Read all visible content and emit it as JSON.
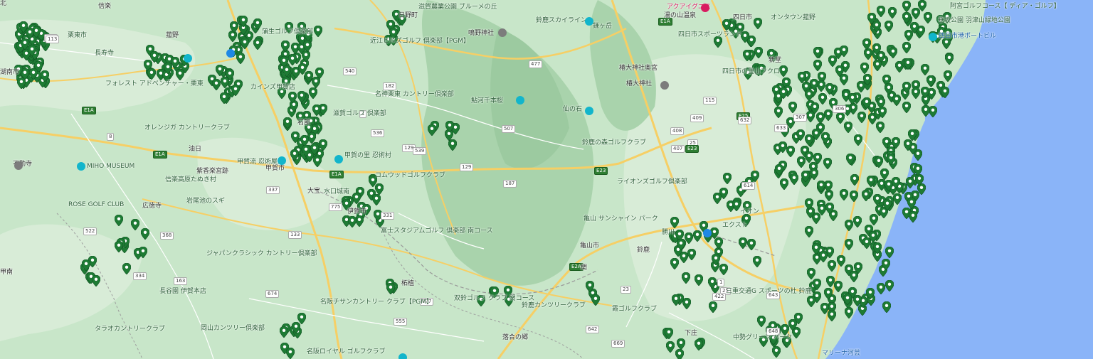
{
  "colors": {
    "land": "#c8e6c9",
    "land_light": "#dcefdc",
    "mountain": "#b3d9b5",
    "sea": "#8ab4f8",
    "road_major": "#f6cf65",
    "road_minor": "#ffffff",
    "pin": "#1e7b34",
    "pin_dark": "#0f5222"
  },
  "labels": [
    {
      "text": "栗東市",
      "style": ""
    },
    {
      "text": "長寿寺",
      "style": ""
    },
    {
      "text": "フォレスト アドベンチャー・栗東",
      "style": ""
    },
    {
      "text": "オレンジガ カントリークラブ",
      "style": ""
    },
    {
      "text": "不動寺",
      "style": "dark"
    },
    {
      "text": "MIHO MUSEUM",
      "style": ""
    },
    {
      "text": "ROSE GOLF CLUB",
      "style": ""
    },
    {
      "text": "ジャパンクラシック カントリー倶楽部",
      "style": ""
    },
    {
      "text": "長谷園 伊賀本店",
      "style": ""
    },
    {
      "text": "タラオカントリークラブ",
      "style": ""
    },
    {
      "text": "岡山カンツリー倶楽部",
      "style": ""
    },
    {
      "text": "名阪チサンカントリー クラブ【PGM】",
      "style": ""
    },
    {
      "text": "名阪ロイヤル ゴルフクラブ",
      "style": ""
    },
    {
      "text": "紫香楽宮跡",
      "style": "dark"
    },
    {
      "text": "信楽高原たぬき村",
      "style": ""
    },
    {
      "text": "甲賀市",
      "style": "dark"
    },
    {
      "text": "甲賀流 忍術屋敷",
      "style": ""
    },
    {
      "text": "甲賀の里 忍術村",
      "style": ""
    },
    {
      "text": "コムウッドゴルフクラブ",
      "style": ""
    },
    {
      "text": "岩尾池のスギ",
      "style": ""
    },
    {
      "text": "富士スタジアムゴルフ 倶楽部 南コース",
      "style": ""
    },
    {
      "text": "柘植",
      "style": "dark"
    },
    {
      "text": "双鈴ゴルフ クラブ 関コース",
      "style": ""
    },
    {
      "text": "鈴鹿カンツリークラブ",
      "style": ""
    },
    {
      "text": "落合の郷",
      "style": "dark"
    },
    {
      "text": "近江ヒルズゴルフ 倶楽部【PGM】",
      "style": ""
    },
    {
      "text": "名神栗東 カントリー倶楽部",
      "style": ""
    },
    {
      "text": "滋賀ゴルフ 倶楽部",
      "style": ""
    },
    {
      "text": "滋賀農業公園 ブルーメの丘",
      "style": ""
    },
    {
      "text": "日野町",
      "style": "dark"
    },
    {
      "text": "鳴野神社",
      "style": "dark"
    },
    {
      "text": "鈴鹿スカイライン",
      "style": ""
    },
    {
      "text": "鎌ヶ岳",
      "style": ""
    },
    {
      "text": "鮎河千本桜",
      "style": ""
    },
    {
      "text": "仙の石",
      "style": ""
    },
    {
      "text": "鈴鹿の森ゴルフクラブ",
      "style": ""
    },
    {
      "text": "ライオンズゴルフ倶楽部",
      "style": ""
    },
    {
      "text": "亀山 サンシャイン パーク",
      "style": ""
    },
    {
      "text": "亀山市",
      "style": "dark"
    },
    {
      "text": "関",
      "style": "dark"
    },
    {
      "text": "霞ゴルフクラブ",
      "style": ""
    },
    {
      "text": "アクアイグニス",
      "style": "pink"
    },
    {
      "text": "湯の山温泉",
      "style": "dark"
    },
    {
      "text": "四日市スポーツランド",
      "style": ""
    },
    {
      "text": "椿大神社奥宮",
      "style": "dark"
    },
    {
      "text": "椿大神社",
      "style": "dark"
    },
    {
      "text": "オンタウン菰野",
      "style": ""
    },
    {
      "text": "四日市港ポートビル",
      "style": "blue"
    },
    {
      "text": "垂坂公園 羽津山緑地公園",
      "style": ""
    },
    {
      "text": "四日市の里山フクロ",
      "style": ""
    },
    {
      "text": "中勢グリーン パーク",
      "style": ""
    },
    {
      "text": "三重交通G スポーツの杜 鈴鹿",
      "style": ""
    },
    {
      "text": "マリーナ河芸",
      "style": "blue"
    },
    {
      "text": "下庄",
      "style": "dark"
    },
    {
      "text": "蒲生ゴルフ倶楽部",
      "style": ""
    },
    {
      "text": "カインズ甲賀店",
      "style": ""
    },
    {
      "text": "水口城南",
      "style": ""
    },
    {
      "text": "伊賀市",
      "style": "dark"
    },
    {
      "text": "油日",
      "style": "dark"
    },
    {
      "text": "広徳寺",
      "style": "dark"
    },
    {
      "text": "勝川",
      "style": ""
    },
    {
      "text": "エクスト",
      "style": ""
    },
    {
      "text": "イオン",
      "style": ""
    },
    {
      "text": "鈴鹿",
      "style": "dark"
    },
    {
      "text": "新堂",
      "style": "dark"
    },
    {
      "text": "四日市",
      "style": "dark"
    },
    {
      "text": "菰野",
      "style": "dark"
    },
    {
      "text": "湖南市",
      "style": "dark"
    },
    {
      "text": "大宝",
      "style": "dark"
    },
    {
      "text": "信楽",
      "style": "dark"
    },
    {
      "text": "石部",
      "style": "dark"
    },
    {
      "text": "甲南",
      "style": "dark"
    },
    {
      "text": "阿宮ゴルフコース【 ディア・ゴルフ】",
      "style": ""
    },
    {
      "text": "北",
      "style": "dark"
    }
  ],
  "route_shields": [
    "1",
    "8",
    "477",
    "306",
    "307",
    "1",
    "25",
    "23",
    "E1A",
    "E1A",
    "E1A",
    "E23",
    "E2A",
    "E25",
    "25",
    "422",
    "163",
    "368",
    "113",
    "540",
    "182",
    "129",
    "507",
    "539",
    "536",
    "129",
    "187",
    "337",
    "775",
    "331",
    "133",
    "674",
    "677",
    "555",
    "642",
    "409",
    "408",
    "407",
    "115",
    "632",
    "633",
    "614",
    "643",
    "648",
    "669",
    "522",
    "334",
    "113",
    "E1A",
    "E23"
  ]
}
